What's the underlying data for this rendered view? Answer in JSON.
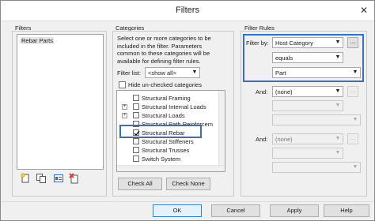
{
  "window": {
    "title": "Filters",
    "close_glyph": "✕"
  },
  "filters": {
    "group_label": "Filters",
    "items": [
      "Rebar Parts"
    ],
    "toolbar": [
      {
        "name": "new-filter-icon"
      },
      {
        "name": "duplicate-filter-icon"
      },
      {
        "name": "rename-filter-icon"
      },
      {
        "name": "delete-filter-icon"
      }
    ]
  },
  "categories": {
    "group_label": "Categories",
    "description": "Select one or more categories to be included in the filter. Parameters common to these categories will be available for defining filter rules.",
    "filter_list_label": "Filter list:",
    "filter_list_value": "<show all>",
    "hide_unchecked_label": "Hide un-checked categories",
    "tree": [
      {
        "label": "Structural Framing",
        "expander": "",
        "checked": false
      },
      {
        "label": "Structural Internal Loads",
        "expander": "+",
        "checked": false
      },
      {
        "label": "Structural Loads",
        "expander": "+",
        "checked": false
      },
      {
        "label": "Structural Path Reinforcem",
        "expander": "",
        "checked": false
      },
      {
        "label": "Structural Rebar",
        "expander": "",
        "checked": true
      },
      {
        "label": "Structural Stiffeners",
        "expander": "",
        "checked": false
      },
      {
        "label": "Structural Trusses",
        "expander": "",
        "checked": false
      },
      {
        "label": "Switch System",
        "expander": "",
        "checked": false
      }
    ],
    "check_all_label": "Check All",
    "check_none_label": "Check None"
  },
  "rules": {
    "group_label": "Filter Rules",
    "filter_by_label": "Filter by:",
    "filter_by_value": "Host Category",
    "operator_value": "equals",
    "value_value": "Part",
    "and_label": "And:",
    "and_rows": [
      {
        "value": "(none)"
      },
      {
        "value": "(none)"
      }
    ],
    "ellipsis_label": "..."
  },
  "footer": {
    "ok_label": "OK",
    "cancel_label": "Cancel",
    "apply_label": "Apply",
    "help_label": "Help"
  },
  "colors": {
    "highlight": "#3a6fb4",
    "window_bg": "#f0f0f0"
  }
}
